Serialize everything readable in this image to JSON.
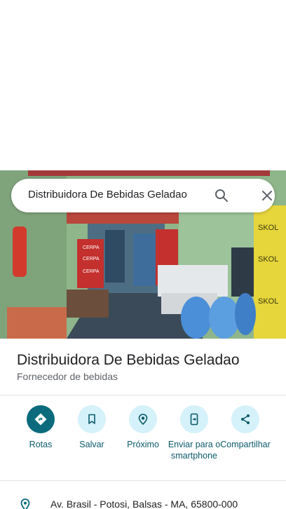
{
  "search": {
    "query": "Distribuidora De Bebidas Geladao"
  },
  "place": {
    "title": "Distribuidora De Bebidas Geladao",
    "category": "Fornecedor de bebidas"
  },
  "actions": [
    {
      "label": "Rotas",
      "icon": "directions-icon"
    },
    {
      "label": "Salvar",
      "icon": "bookmark-icon"
    },
    {
      "label": "Próximo",
      "icon": "nearby-icon"
    },
    {
      "label": "Enviar para o smartphone",
      "icon": "send-to-phone-icon"
    },
    {
      "label": "Compartilhar",
      "icon": "share-icon"
    }
  ],
  "address": {
    "text": "Av. Brasil - Potosi, Balsas - MA, 65800-000",
    "icon": "location-pin-icon"
  },
  "photo": {
    "signs": [
      "CERPA",
      "CERPA",
      "CERPA",
      "SKOL",
      "SKOL",
      "SKOL"
    ]
  },
  "colors": {
    "accent": "#0b6b7d",
    "action_bg": "#d5f1fa",
    "label": "#0b5a6a"
  }
}
